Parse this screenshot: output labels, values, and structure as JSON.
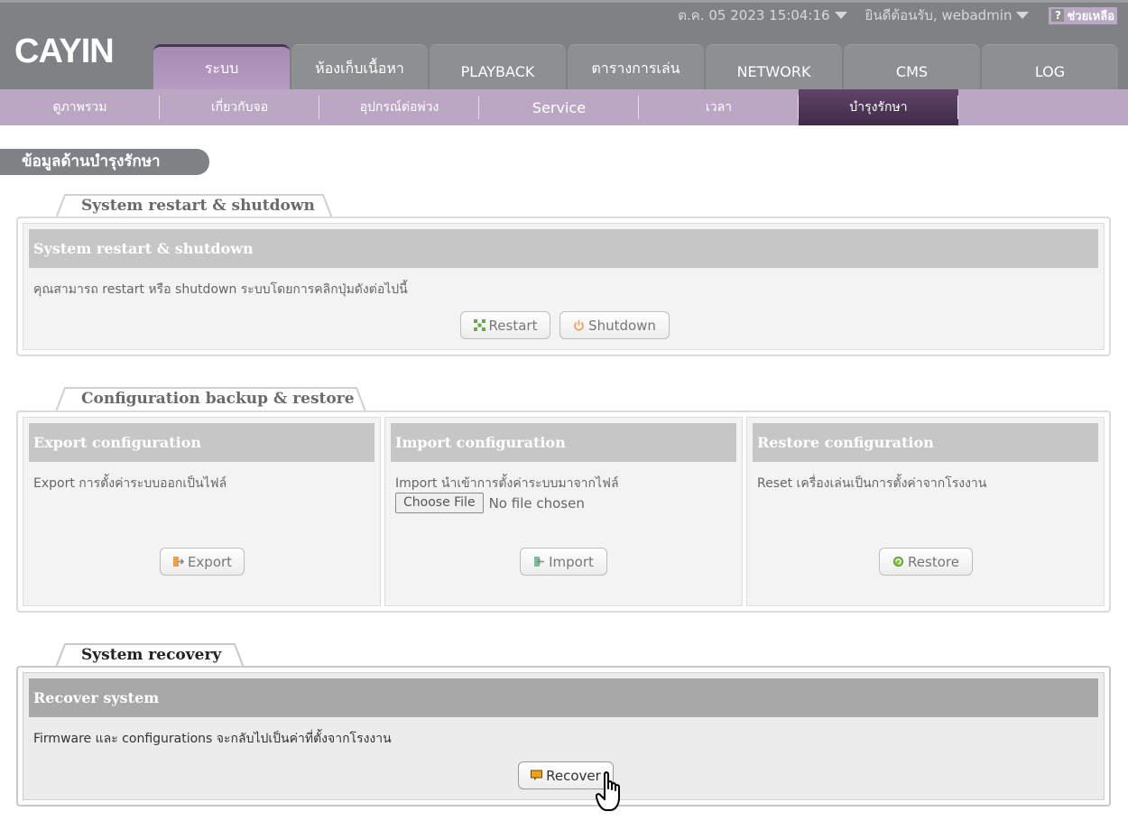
{
  "header": {
    "logo_text": "CAYIN",
    "datetime": "ต.ค. 05 2023 15:04:16",
    "welcome": "ยินดีต้อนรับ, webadmin",
    "help_label": "ช่วยเหลือ",
    "help_icon": "?",
    "main_tabs": [
      {
        "label": "ระบบ",
        "active": true
      },
      {
        "label": "ห้องเก็บเนื้อหา",
        "active": false
      },
      {
        "label": "PLAYBACK",
        "active": false
      },
      {
        "label": "ตารางการเล่น",
        "active": false
      },
      {
        "label": "NETWORK",
        "active": false
      },
      {
        "label": "CMS",
        "active": false
      },
      {
        "label": "LOG",
        "active": false
      }
    ]
  },
  "subnav": {
    "items": [
      {
        "label": "ดูภาพรวม",
        "active": false
      },
      {
        "label": "เกี่ยวกับจอ",
        "active": false
      },
      {
        "label": "อุปกรณ์ต่อพ่วง",
        "active": false
      },
      {
        "label": "Service",
        "active": false
      },
      {
        "label": "เวลา",
        "active": false
      },
      {
        "label": "บำรุงรักษา",
        "active": true
      }
    ]
  },
  "page_title": "ข้อมูลด้านบำรุงรักษา",
  "sections": {
    "restart": {
      "tab_label": "System restart & shutdown",
      "panel_title": "System restart & shutdown",
      "description": "คุณสามารถ restart หรือ shutdown ระบบโดยการคลิกปุ่มดังต่อไปนี้",
      "restart_label": "Restart",
      "shutdown_label": "Shutdown"
    },
    "config": {
      "tab_label": "Configuration backup & restore",
      "export": {
        "title": "Export configuration",
        "description": "Export การตั้งค่าระบบออกเป็นไฟล์",
        "button": "Export"
      },
      "import": {
        "title": "Import configuration",
        "description": "Import นำเข้าการตั้งค่าระบบมาจากไฟล์",
        "choose_file": "Choose File",
        "file_status": "No file chosen",
        "button": "Import"
      },
      "restore": {
        "title": "Restore configuration",
        "description": "Reset เครื่องเล่นเป็นการตั้งค่าจากโรงงาน",
        "button": "Restore"
      }
    },
    "recovery": {
      "tab_label": "System recovery",
      "panel_title": "Recover system",
      "description": "Firmware และ configurations จะกลับไปเป็นค่าที่ตั้งจากโรงงาน",
      "button": "Recover"
    }
  },
  "colors": {
    "header_bg": "#7f8284",
    "accent_purple": "#b89cc3",
    "active_subtab": "#4f3858",
    "panel_head": "#c6c6c6",
    "recovery_head": "#a8a8a8"
  }
}
